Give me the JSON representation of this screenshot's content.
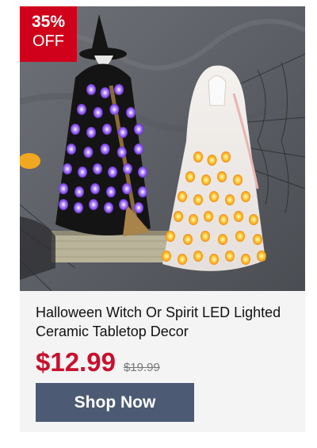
{
  "badge": {
    "percent": "35%",
    "label": "OFF"
  },
  "product": {
    "title": "Halloween Witch Or Spirit LED Lighted Ceramic Tabletop Decor",
    "price": "$12.99",
    "original_price": "$19.99",
    "image_alt": "Black ceramic witch and white ceramic ghost with glowing purple and candy-corn LED lights"
  },
  "cta": {
    "label": "Shop Now"
  },
  "colors": {
    "accent": "#d0021b",
    "price": "#c8102e",
    "button": "#4c5b73"
  }
}
